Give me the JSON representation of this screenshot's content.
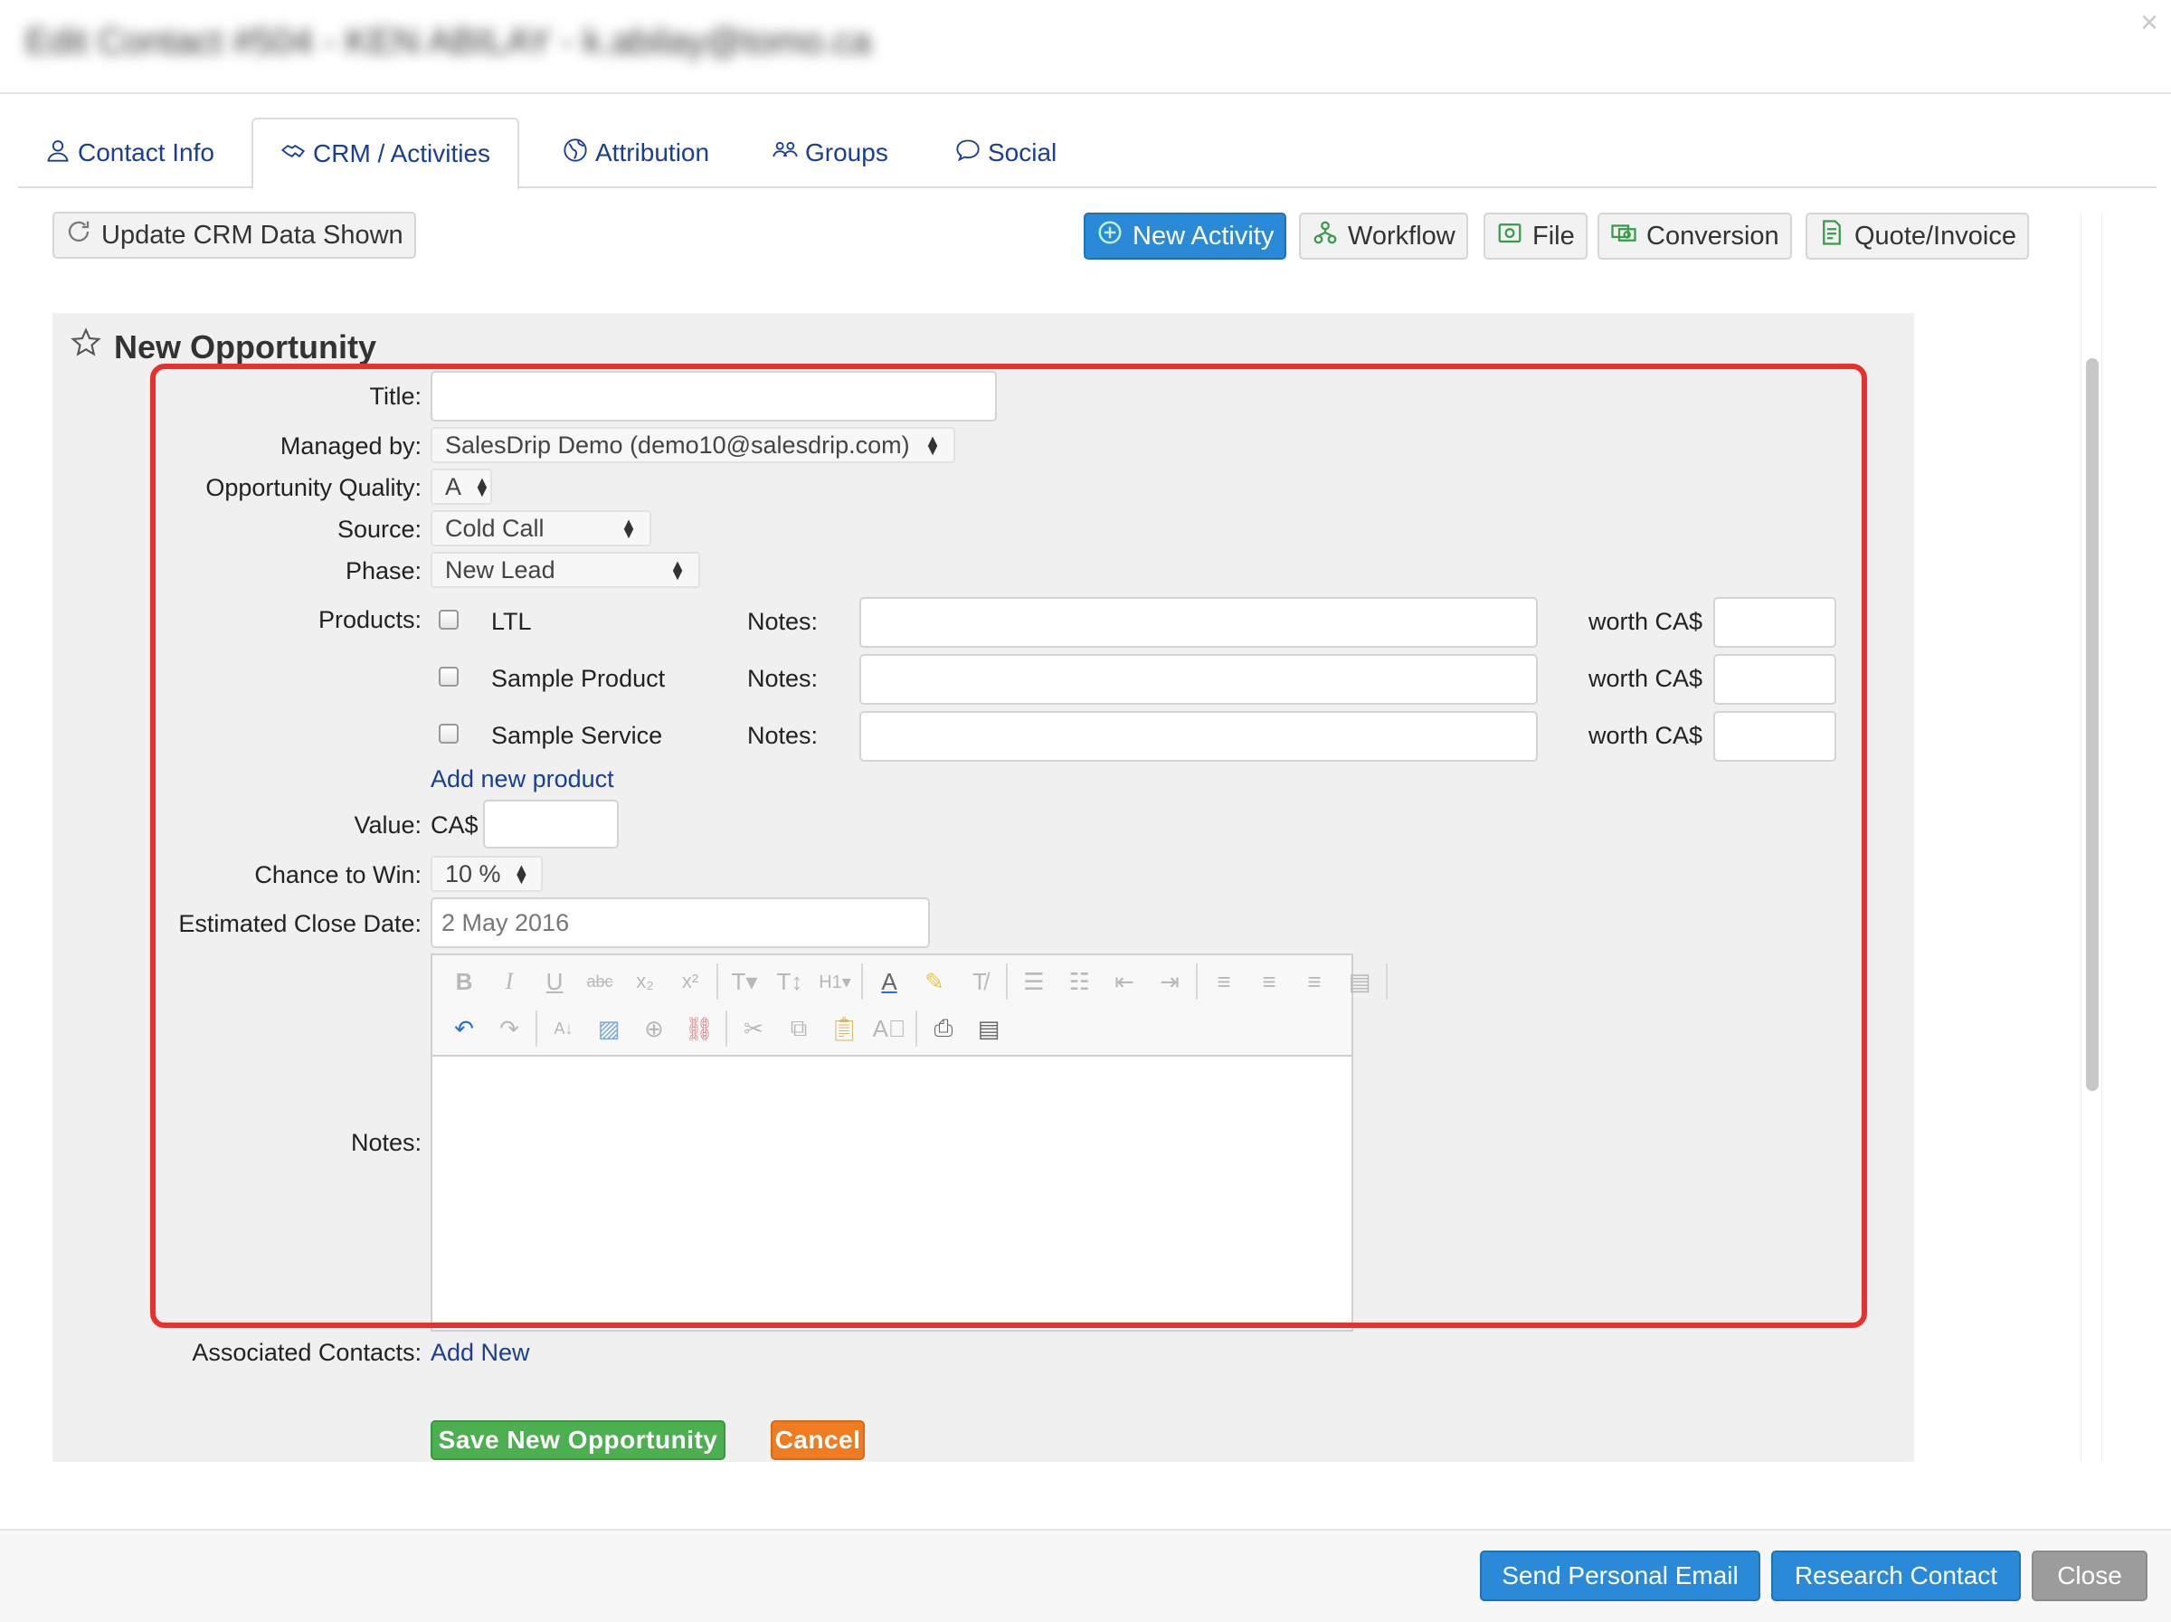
{
  "header": {
    "title": "Edit Contact #504 - KEN ABILAY - k.abilay@tomo.ca",
    "close_glyph": "×"
  },
  "tabs": [
    {
      "label": "Contact Info",
      "icon": "user-icon"
    },
    {
      "label": "CRM / Activities",
      "icon": "handshake-icon"
    },
    {
      "label": "Attribution",
      "icon": "globe-icon"
    },
    {
      "label": "Groups",
      "icon": "group-icon"
    },
    {
      "label": "Social",
      "icon": "chat-bubble-icon"
    }
  ],
  "toolbar": {
    "update_label": "Update CRM Data Shown",
    "new_activity_label": "New Activity",
    "workflow_label": "Workflow",
    "file_label": "File",
    "conversion_label": "Conversion",
    "quote_label": "Quote/Invoice"
  },
  "form": {
    "heading": "New Opportunity",
    "title_label": "Title:",
    "title_value": "",
    "managed_label": "Managed by:",
    "managed_value": "SalesDrip Demo (demo10@salesdrip.com)",
    "quality_label": "Opportunity Quality:",
    "quality_value": "A",
    "source_label": "Source:",
    "source_value": "Cold Call",
    "phase_label": "Phase:",
    "phase_value": "New Lead",
    "products_label": "Products:",
    "notes_label": "Notes:",
    "worth_label": "worth CA$",
    "products": [
      {
        "name": "LTL",
        "notes": "",
        "worth": ""
      },
      {
        "name": "Sample Product",
        "notes": "",
        "worth": ""
      },
      {
        "name": "Sample Service",
        "notes": "",
        "worth": ""
      }
    ],
    "add_product_label": "Add new product",
    "value_label": "Value:",
    "value_currency": "CA$",
    "value_value": "",
    "chance_label": "Chance to Win:",
    "chance_value": "10 %",
    "close_date_label": "Estimated Close Date:",
    "close_date_value": "2 May 2016",
    "notes_editor_label": "Notes:",
    "associated_label": "Associated Contacts:",
    "add_new_label": "Add New",
    "save_label": "Save New Opportunity",
    "cancel_label": "Cancel"
  },
  "footer": {
    "send_email_label": "Send Personal Email",
    "research_label": "Research Contact",
    "close_label": "Close"
  },
  "colors": {
    "primary_blue": "#2b8ad8",
    "link_blue": "#1a3e96",
    "save_green": "#4caf50",
    "cancel_orange": "#f07c22",
    "highlight_red": "#e8312d",
    "close_gray": "#9c9c9c"
  }
}
